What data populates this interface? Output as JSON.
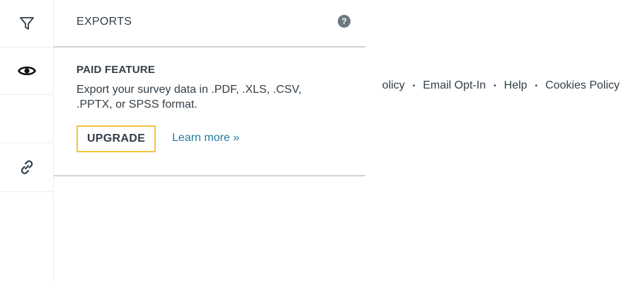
{
  "sidebar": {
    "items": [
      {
        "name": "filter",
        "icon": "filter-icon"
      },
      {
        "name": "view",
        "icon": "eye-icon"
      },
      {
        "name": "share",
        "icon": "link-icon"
      }
    ]
  },
  "footer": {
    "links": [
      "olicy",
      "Email Opt-In",
      "Help",
      "Cookies Policy"
    ],
    "separator": "•"
  },
  "exports_panel": {
    "title": "EXPORTS",
    "help_icon": "question-circle-icon",
    "help_glyph": "?",
    "paid_label": "PAID FEATURE",
    "description": "Export your survey data in .PDF, .XLS, .CSV, .PPTX, or SPSS format.",
    "upgrade_label": "UPGRADE",
    "learn_more_label": "Learn more »"
  },
  "colors": {
    "text": "#333e48",
    "link": "#1f7c9c",
    "upgrade_border": "#f3c43a",
    "divider": "#d0d2d3",
    "help_icon_bg": "#6b787f"
  }
}
